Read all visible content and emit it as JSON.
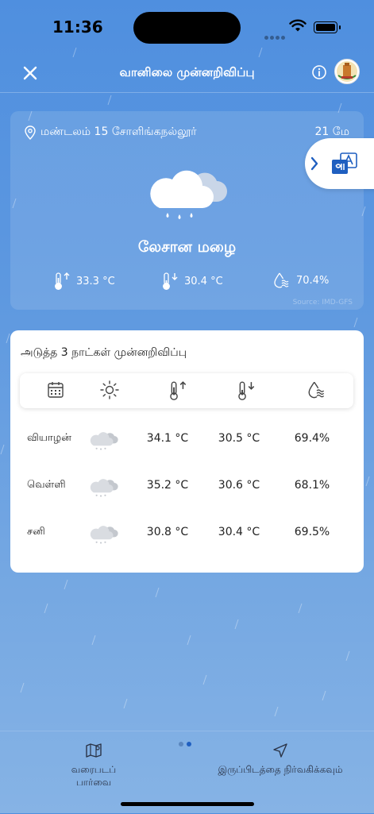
{
  "status_bar": {
    "time": "11:36"
  },
  "header": {
    "title": "வானிலை முன்னறிவிப்பு"
  },
  "current": {
    "location": "மண்டலம் 15 சோளிங்கநல்லூர்",
    "date": "21 மே",
    "condition": "லேசான மழை",
    "max_temp": "33.3 °C",
    "min_temp": "30.4 °C",
    "humidity": "70.4%",
    "source": "Source: IMD-GFS"
  },
  "forecast": {
    "title": "அடுத்த 3 நாட்கள் முன்னறிவிப்பு",
    "rows": [
      {
        "day": "வியாழன்",
        "icon": "light-rain-cloud",
        "max": "34.1 °C",
        "min": "30.5 °C",
        "humidity": "69.4%"
      },
      {
        "day": "வெள்ளி",
        "icon": "light-rain-cloud",
        "max": "35.2 °C",
        "min": "30.6 °C",
        "humidity": "68.1%"
      },
      {
        "day": "சனி",
        "icon": "light-rain-cloud",
        "max": "30.8 °C",
        "min": "30.4 °C",
        "humidity": "69.5%"
      }
    ]
  },
  "tabs": {
    "map_view": "வரைபடப் பார்வை",
    "manage_location": "இருப்பிடத்தை நிர்வகிக்கவும்"
  },
  "colors": {
    "accent": "#1f5fc0",
    "background_top": "#4f8fdf",
    "card": "#ffffff"
  }
}
